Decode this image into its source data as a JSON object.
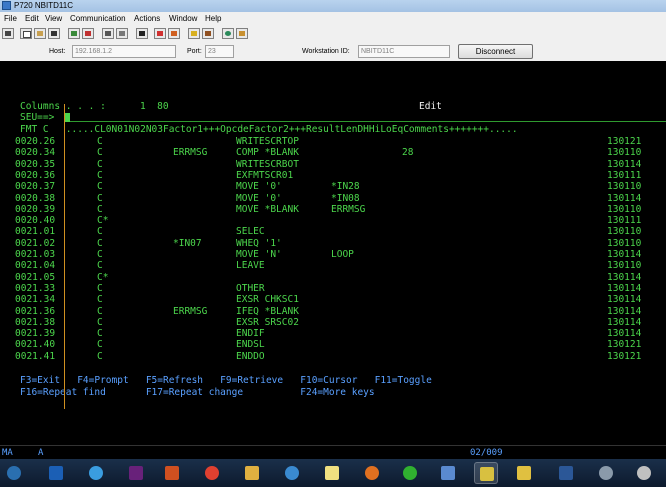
{
  "window": {
    "title": "P720 NBITD11C"
  },
  "menu": [
    "File",
    "Edit",
    "View",
    "Communication",
    "Actions",
    "Window",
    "Help"
  ],
  "hostbar": {
    "host_label": "Host:",
    "host_value": "192.168.1.2",
    "port_label": "Port:",
    "port_value": "23",
    "workstation_label": "Workstation ID:",
    "workstation_value": "NBITD11C",
    "disconnect_label": "Disconnect"
  },
  "screen": {
    "columns_label": "Columns . . . :",
    "columns_value": "1  80",
    "mode": "Edit",
    "seu_prompt": "SEU==>",
    "format_line": "FMT C   .....CL0N01N02N03Factor1+++OpcdeFactor2+++ResultLenDHHiLoEqComments+++++++.....",
    "lines": [
      {
        "seq": "0020.26",
        "spec": "C",
        "factor1": "",
        "opcode": "WRITESCRTOP",
        "factor2": "",
        "result": "",
        "len": "",
        "date": "130121"
      },
      {
        "seq": "0020.34",
        "spec": "C",
        "factor1": "ERRMSG",
        "opcode": "COMP *BLANK",
        "factor2": "",
        "result": "",
        "len": "28",
        "date": "130110"
      },
      {
        "seq": "0020.35",
        "spec": "C",
        "factor1": "",
        "opcode": "WRITESCRBOT",
        "factor2": "",
        "result": "",
        "len": "",
        "date": "130114"
      },
      {
        "seq": "0020.36",
        "spec": "C",
        "factor1": "",
        "opcode": "EXFMTSCR01",
        "factor2": "",
        "result": "",
        "len": "",
        "date": "130111"
      },
      {
        "seq": "0020.37",
        "spec": "C",
        "factor1": "",
        "opcode": "MOVE '0'",
        "factor2": "",
        "result": "*IN28",
        "len": "",
        "date": "130110"
      },
      {
        "seq": "0020.38",
        "spec": "C",
        "factor1": "",
        "opcode": "MOVE '0'",
        "factor2": "",
        "result": "*IN08",
        "len": "",
        "date": "130114"
      },
      {
        "seq": "0020.39",
        "spec": "C",
        "factor1": "",
        "opcode": "MOVE *BLANK",
        "factor2": "",
        "result": "ERRMSG",
        "len": "",
        "date": "130110"
      },
      {
        "seq": "0020.40",
        "spec": "C*",
        "factor1": "",
        "opcode": "",
        "factor2": "",
        "result": "",
        "len": "",
        "date": "130111"
      },
      {
        "seq": "0021.01",
        "spec": "C",
        "factor1": "",
        "opcode": "SELEC",
        "factor2": "",
        "result": "",
        "len": "",
        "date": "130110"
      },
      {
        "seq": "0021.02",
        "spec": "C",
        "factor1": "*IN07",
        "opcode": "WHEQ '1'",
        "factor2": "",
        "result": "",
        "len": "",
        "date": "130110"
      },
      {
        "seq": "0021.03",
        "spec": "C",
        "factor1": "",
        "opcode": "MOVE 'N'",
        "factor2": "",
        "result": "LOOP",
        "len": "",
        "date": "130114"
      },
      {
        "seq": "0021.04",
        "spec": "C",
        "factor1": "",
        "opcode": "LEAVE",
        "factor2": "",
        "result": "",
        "len": "",
        "date": "130110"
      },
      {
        "seq": "0021.05",
        "spec": "C*",
        "factor1": "",
        "opcode": "",
        "factor2": "",
        "result": "",
        "len": "",
        "date": "130114"
      },
      {
        "seq": "0021.33",
        "spec": "C",
        "factor1": "",
        "opcode": "OTHER",
        "factor2": "",
        "result": "",
        "len": "",
        "date": "130114"
      },
      {
        "seq": "0021.34",
        "spec": "C",
        "factor1": "",
        "opcode": "EXSR CHKSC1",
        "factor2": "",
        "result": "",
        "len": "",
        "date": "130114"
      },
      {
        "seq": "0021.36",
        "spec": "C",
        "factor1": "ERRMSG",
        "opcode": "IFEQ *BLANK",
        "factor2": "",
        "result": "",
        "len": "",
        "date": "130114"
      },
      {
        "seq": "0021.38",
        "spec": "C",
        "factor1": "",
        "opcode": "EXSR SRSC02",
        "factor2": "",
        "result": "",
        "len": "",
        "date": "130114"
      },
      {
        "seq": "0021.39",
        "spec": "C",
        "factor1": "",
        "opcode": "ENDIF",
        "factor2": "",
        "result": "",
        "len": "",
        "date": "130114"
      },
      {
        "seq": "0021.40",
        "spec": "C",
        "factor1": "",
        "opcode": "ENDSL",
        "factor2": "",
        "result": "",
        "len": "",
        "date": "130121"
      },
      {
        "seq": "0021.41",
        "spec": "C",
        "factor1": "",
        "opcode": "ENDDO",
        "factor2": "",
        "result": "",
        "len": "",
        "date": "130121"
      }
    ],
    "fkeys_row1": "F3=Exit   F4=Prompt   F5=Refresh   F9=Retrieve   F10=Cursor   F11=Toggle",
    "fkeys_row2": "F16=Repeat find       F17=Repeat change          F24=More keys"
  },
  "status": {
    "left": "MA",
    "mode": "A",
    "position": "02/009"
  },
  "colors": {
    "terminal_green": "#4cd64c",
    "terminal_white": "#f0f0f0",
    "terminal_blue": "#5aa0ff",
    "column_separator": "#d09020"
  },
  "taskbar_icons": [
    "outlook-icon",
    "internet-explorer-icon",
    "visual-studio-icon",
    "media-player-icon",
    "chrome-icon",
    "file-explorer-icon",
    "refresh-app-icon",
    "sticky-notes-icon",
    "firefox-icon",
    "line-icon",
    "paint-icon",
    "security-shield-icon",
    "notes-icon",
    "word-icon",
    "tools-icon",
    "misc-icon"
  ]
}
